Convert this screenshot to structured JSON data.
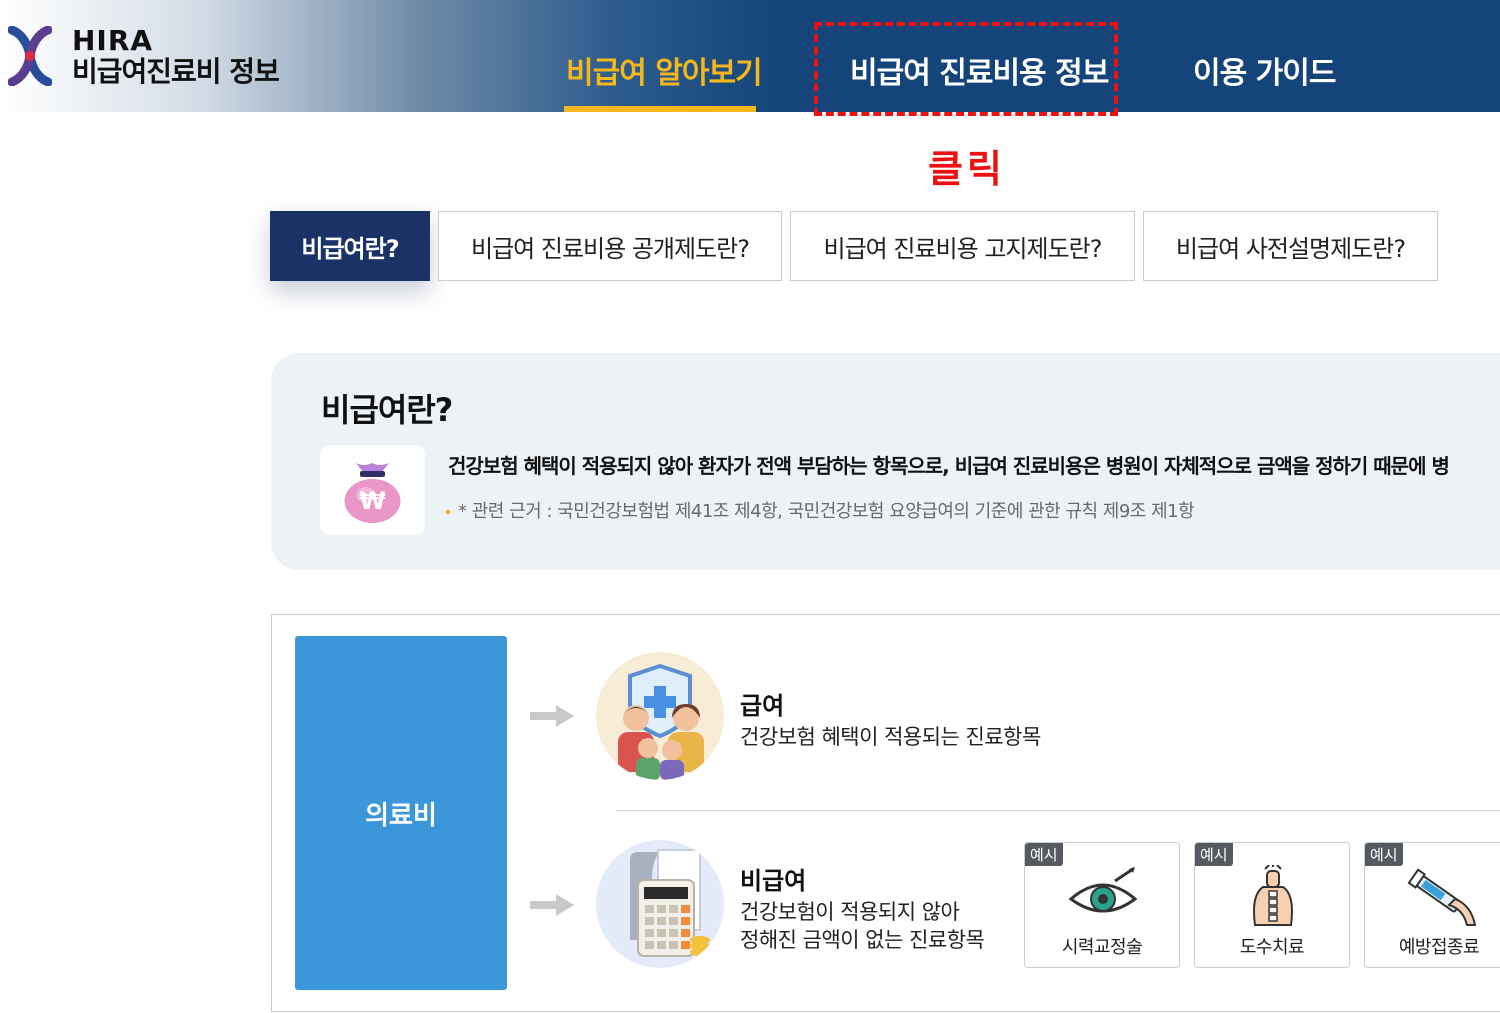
{
  "header": {
    "logo": {
      "line1": "HIRA",
      "line2": "비급여진료비 정보"
    },
    "nav": [
      {
        "label": "비급여 알아보기",
        "active": true
      },
      {
        "label": "비급여 진료비용 정보",
        "active": false
      },
      {
        "label": "이용 가이드",
        "active": false
      }
    ],
    "annotation": "클릭"
  },
  "tabs": [
    {
      "label": "비급여란?",
      "active": true
    },
    {
      "label": "비급여 진료비용 공개제도란?",
      "active": false
    },
    {
      "label": "비급여 진료비용 고지제도란?",
      "active": false
    },
    {
      "label": "비급여 사전설명제도란?",
      "active": false
    }
  ],
  "info": {
    "title": "비급여란?",
    "icon": "money-bag-won-icon",
    "description": "건강보험 혜택이 적용되지 않아 환자가 전액 부담하는 항목으로, 비급여 진료비용은 병원이 자체적으로 금액을 정하기 때문에 병",
    "note": "* 관련 근거 : 국민건강보험법 제41조 제4항, 국민건강보험 요양급여의 기준에 관한 규칙 제9조 제1항"
  },
  "diagram": {
    "root_label": "의료비",
    "categories": [
      {
        "title": "급여",
        "description": [
          "건강보험 혜택이 적용되는 진료항목"
        ],
        "icon": "family-shield-icon"
      },
      {
        "title": "비급여",
        "description": [
          "건강보험이 적용되지 않아",
          "정해진 금액이 없는 진료항목"
        ],
        "icon": "calculator-icon"
      }
    ],
    "examples": [
      {
        "badge": "예시",
        "label": "시력교정술",
        "icon": "eye-icon"
      },
      {
        "badge": "예시",
        "label": "도수치료",
        "icon": "spine-therapy-icon"
      },
      {
        "badge": "예시",
        "label": "예방접종료",
        "icon": "syringe-icon"
      }
    ]
  },
  "colors": {
    "header_navy": "#15447a",
    "nav_active": "#f5b81c",
    "annotation_red": "#ee1111",
    "tab_active": "#1a3266",
    "medical_box": "#3b97da",
    "panel_bg": "#edf2f6"
  }
}
